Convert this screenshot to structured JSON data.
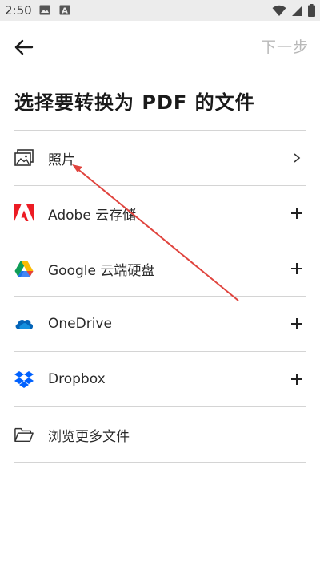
{
  "status_bar": {
    "time": "2:50",
    "icons": [
      "image-notification-icon",
      "a-notification-icon",
      "wifi-icon",
      "signal-icon",
      "battery-icon"
    ]
  },
  "header": {
    "back_icon": "arrow-left-icon",
    "next_label": "下一步",
    "title": "选择要转换为 PDF 的文件"
  },
  "sources": [
    {
      "label": "照片",
      "icon": "photo-icon",
      "action": "chevron-right-icon"
    },
    {
      "label": "Adobe 云存储",
      "icon": "adobe-logo-icon",
      "action": "plus-icon"
    },
    {
      "label": "Google 云端硬盘",
      "icon": "google-drive-icon",
      "action": "plus-icon"
    },
    {
      "label": "OneDrive",
      "icon": "onedrive-icon",
      "action": "plus-icon"
    },
    {
      "label": "Dropbox",
      "icon": "dropbox-icon",
      "action": "plus-icon"
    },
    {
      "label": "浏览更多文件",
      "icon": "folder-icon",
      "action": ""
    }
  ],
  "colors": {
    "adobe": "#ec1c24",
    "onedrive": "#0364b8",
    "dropbox": "#0061ff",
    "annotation": "#e0443e",
    "next_disabled": "#b9b9b9"
  }
}
